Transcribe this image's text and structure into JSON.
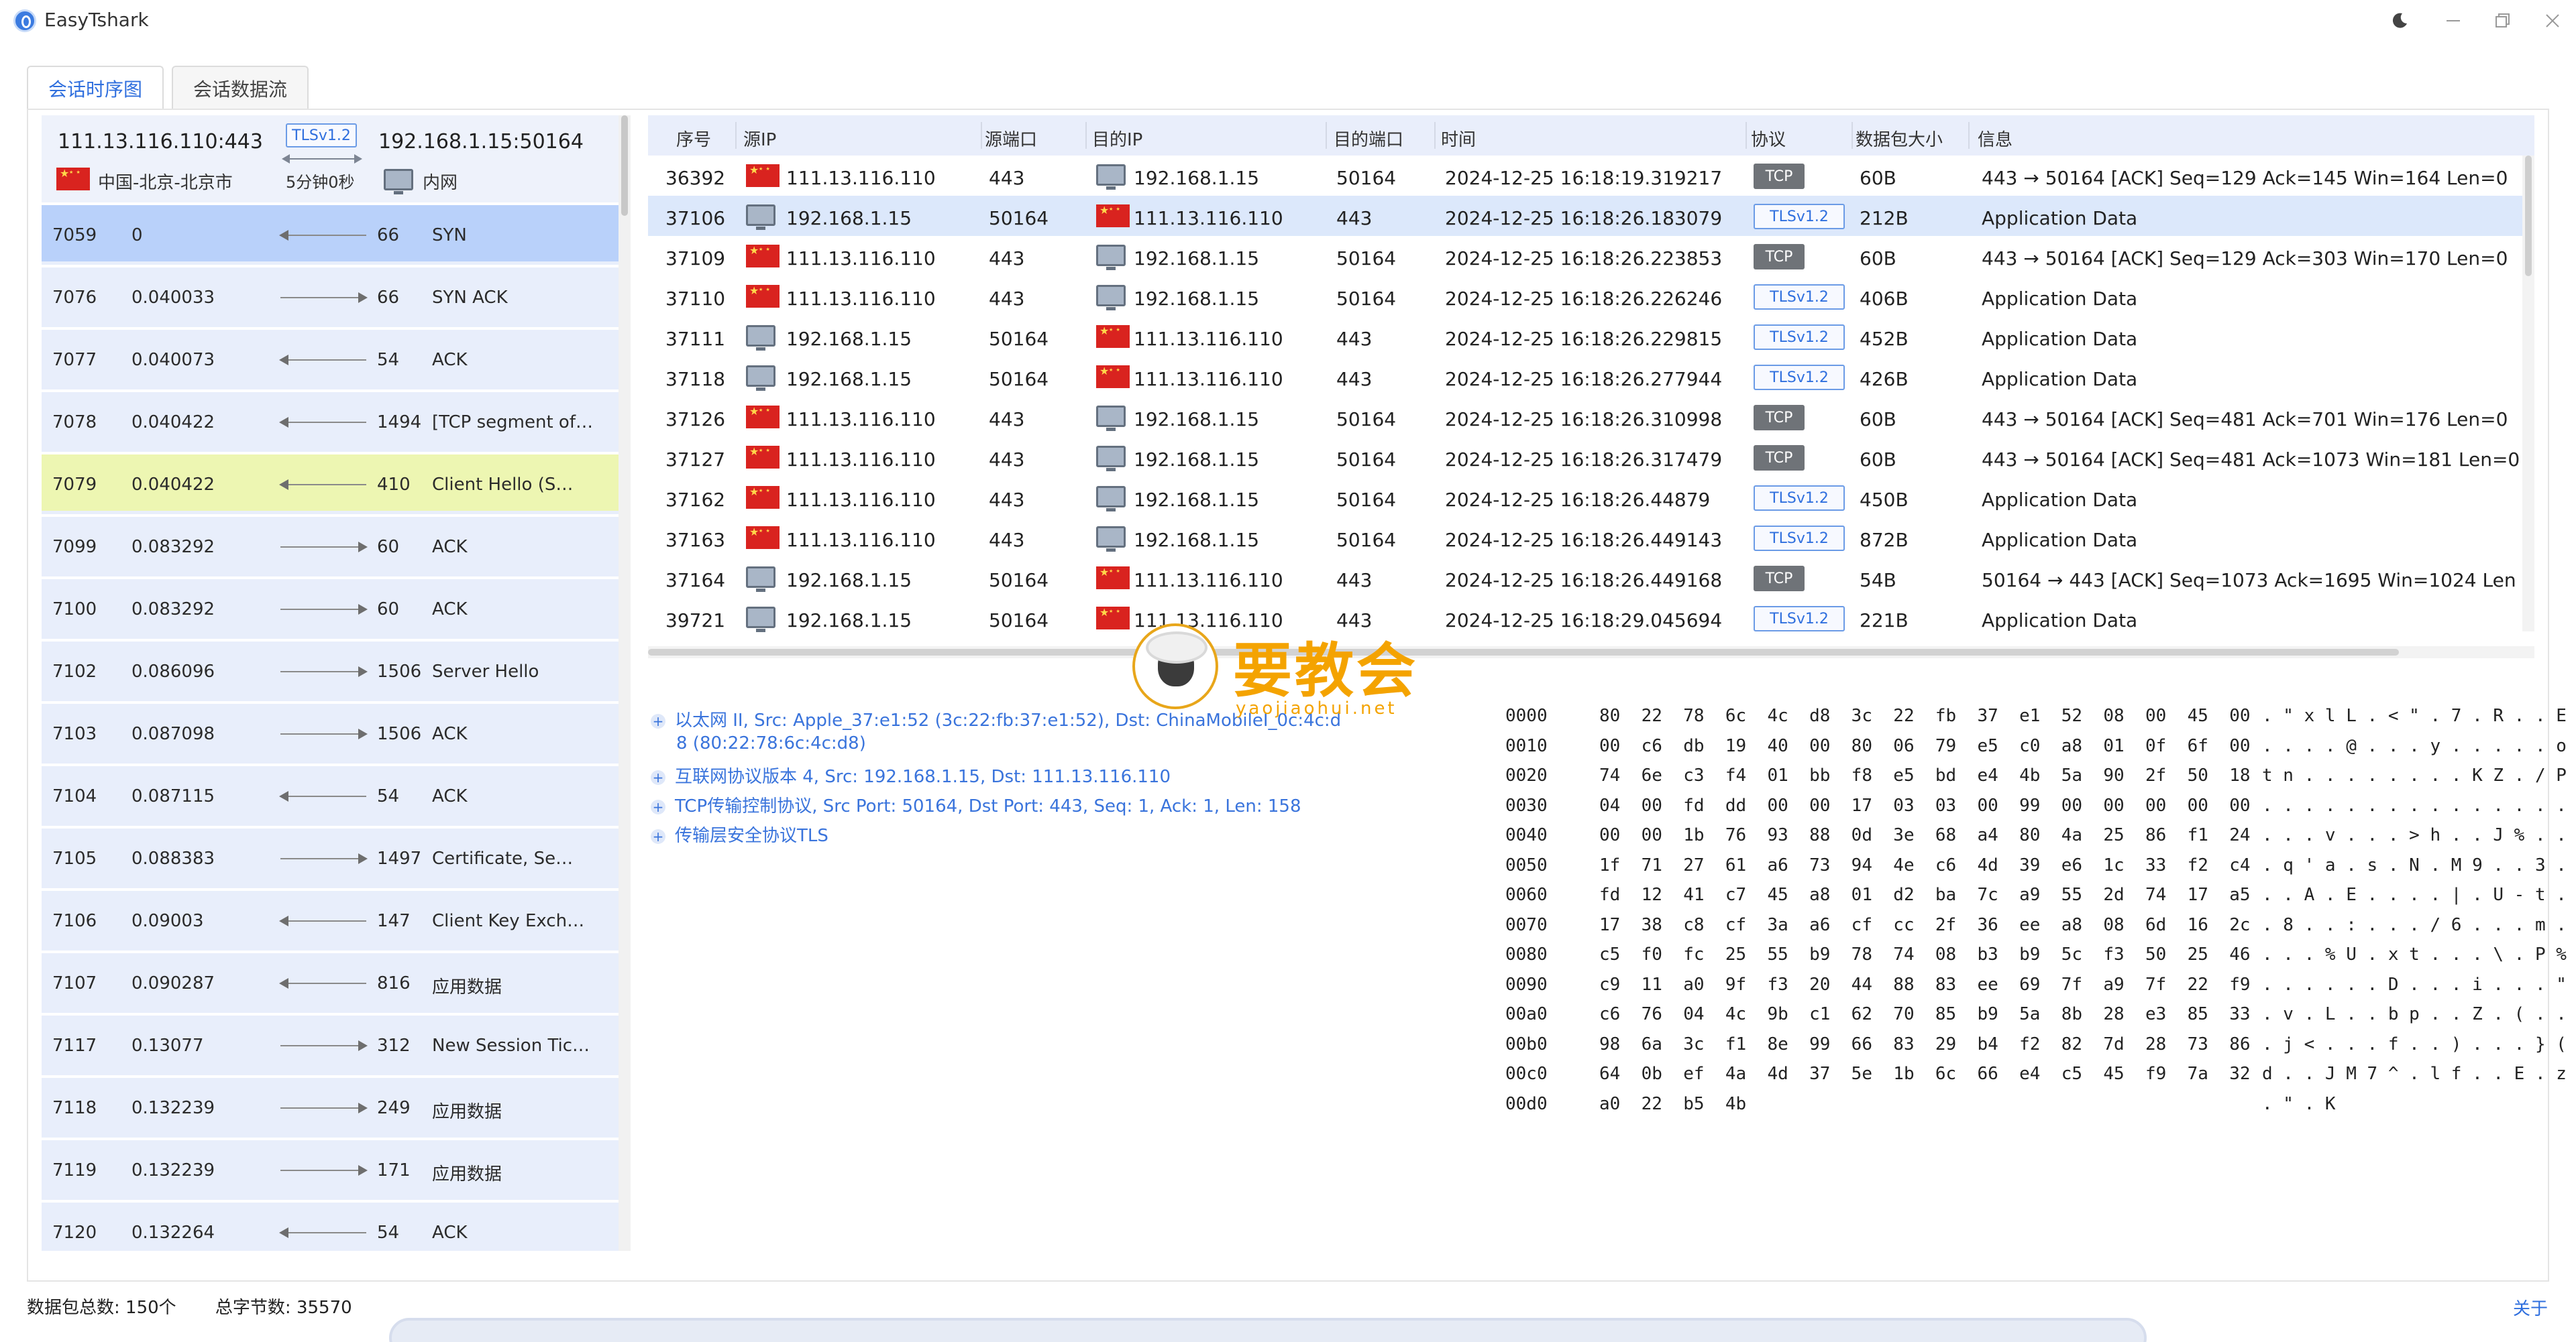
{
  "window": {
    "title": "EasyTshark"
  },
  "tabs": [
    {
      "label": "会话时序图"
    },
    {
      "label": "会话数据流"
    }
  ],
  "session": {
    "src": "111.13.116.110:443",
    "dst": "192.168.1.15:50164",
    "protocol": "TLSv1.2",
    "src_location": "中国-北京-北京市",
    "duration": "5分钟0秒",
    "dst_location": "内网"
  },
  "sequence": [
    {
      "no": "7059",
      "time": "0",
      "len": "66",
      "info": "SYN",
      "dir": "l",
      "state": "sel"
    },
    {
      "no": "7076",
      "time": "0.040033",
      "len": "66",
      "info": "SYN ACK",
      "dir": "r",
      "state": ""
    },
    {
      "no": "7077",
      "time": "0.040073",
      "len": "54",
      "info": "ACK",
      "dir": "l",
      "state": ""
    },
    {
      "no": "7078",
      "time": "0.040422",
      "len": "1494",
      "info": "[TCP segment of…",
      "dir": "l",
      "state": ""
    },
    {
      "no": "7079",
      "time": "0.040422",
      "len": "410",
      "info": "Client Hello (S…",
      "dir": "l",
      "state": "hl"
    },
    {
      "no": "7099",
      "time": "0.083292",
      "len": "60",
      "info": "ACK",
      "dir": "r",
      "state": ""
    },
    {
      "no": "7100",
      "time": "0.083292",
      "len": "60",
      "info": "ACK",
      "dir": "r",
      "state": ""
    },
    {
      "no": "7102",
      "time": "0.086096",
      "len": "1506",
      "info": "Server Hello",
      "dir": "r",
      "state": ""
    },
    {
      "no": "7103",
      "time": "0.087098",
      "len": "1506",
      "info": "ACK",
      "dir": "r",
      "state": ""
    },
    {
      "no": "7104",
      "time": "0.087115",
      "len": "54",
      "info": "ACK",
      "dir": "l",
      "state": ""
    },
    {
      "no": "7105",
      "time": "0.088383",
      "len": "1497",
      "info": "Certificate, Se…",
      "dir": "r",
      "state": ""
    },
    {
      "no": "7106",
      "time": "0.09003",
      "len": "147",
      "info": "Client Key Exch…",
      "dir": "l",
      "state": ""
    },
    {
      "no": "7107",
      "time": "0.090287",
      "len": "816",
      "info": "应用数据",
      "dir": "l",
      "state": ""
    },
    {
      "no": "7117",
      "time": "0.13077",
      "len": "312",
      "info": "New Session Tic…",
      "dir": "r",
      "state": ""
    },
    {
      "no": "7118",
      "time": "0.132239",
      "len": "249",
      "info": "应用数据",
      "dir": "r",
      "state": ""
    },
    {
      "no": "7119",
      "time": "0.132239",
      "len": "171",
      "info": "应用数据",
      "dir": "r",
      "state": ""
    },
    {
      "no": "7120",
      "time": "0.132264",
      "len": "54",
      "info": "ACK",
      "dir": "l",
      "state": ""
    }
  ],
  "packet_table": {
    "columns": [
      "序号",
      "源IP",
      "源端口",
      "目的IP",
      "目的端口",
      "时间",
      "协议",
      "数据包大小",
      "信息"
    ],
    "rows": [
      {
        "no": "36392",
        "src_ip": "111.13.116.110",
        "src_flag": "cn",
        "src_port": "443",
        "dst_ip": "192.168.1.15",
        "dst_flag": "lan",
        "dst_port": "50164",
        "time": "2024-12-25 16:18:19.319217",
        "proto": "TCP",
        "size": "60B",
        "info": "443 → 50164 [ACK] Seq=129 Ack=145 Win=164 Len=0",
        "sel": false
      },
      {
        "no": "37106",
        "src_ip": "192.168.1.15",
        "src_flag": "lan",
        "src_port": "50164",
        "dst_ip": "111.13.116.110",
        "dst_flag": "cn",
        "dst_port": "443",
        "time": "2024-12-25 16:18:26.183079",
        "proto": "TLSv1.2",
        "size": "212B",
        "info": "Application Data",
        "sel": true
      },
      {
        "no": "37109",
        "src_ip": "111.13.116.110",
        "src_flag": "cn",
        "src_port": "443",
        "dst_ip": "192.168.1.15",
        "dst_flag": "lan",
        "dst_port": "50164",
        "time": "2024-12-25 16:18:26.223853",
        "proto": "TCP",
        "size": "60B",
        "info": "443 → 50164 [ACK] Seq=129 Ack=303 Win=170 Len=0",
        "sel": false
      },
      {
        "no": "37110",
        "src_ip": "111.13.116.110",
        "src_flag": "cn",
        "src_port": "443",
        "dst_ip": "192.168.1.15",
        "dst_flag": "lan",
        "dst_port": "50164",
        "time": "2024-12-25 16:18:26.226246",
        "proto": "TLSv1.2",
        "size": "406B",
        "info": "Application Data",
        "sel": false
      },
      {
        "no": "37111",
        "src_ip": "192.168.1.15",
        "src_flag": "lan",
        "src_port": "50164",
        "dst_ip": "111.13.116.110",
        "dst_flag": "cn",
        "dst_port": "443",
        "time": "2024-12-25 16:18:26.229815",
        "proto": "TLSv1.2",
        "size": "452B",
        "info": "Application Data",
        "sel": false
      },
      {
        "no": "37118",
        "src_ip": "192.168.1.15",
        "src_flag": "lan",
        "src_port": "50164",
        "dst_ip": "111.13.116.110",
        "dst_flag": "cn",
        "dst_port": "443",
        "time": "2024-12-25 16:18:26.277944",
        "proto": "TLSv1.2",
        "size": "426B",
        "info": "Application Data",
        "sel": false
      },
      {
        "no": "37126",
        "src_ip": "111.13.116.110",
        "src_flag": "cn",
        "src_port": "443",
        "dst_ip": "192.168.1.15",
        "dst_flag": "lan",
        "dst_port": "50164",
        "time": "2024-12-25 16:18:26.310998",
        "proto": "TCP",
        "size": "60B",
        "info": "443 → 50164 [ACK] Seq=481 Ack=701 Win=176 Len=0",
        "sel": false
      },
      {
        "no": "37127",
        "src_ip": "111.13.116.110",
        "src_flag": "cn",
        "src_port": "443",
        "dst_ip": "192.168.1.15",
        "dst_flag": "lan",
        "dst_port": "50164",
        "time": "2024-12-25 16:18:26.317479",
        "proto": "TCP",
        "size": "60B",
        "info": "443 → 50164 [ACK] Seq=481 Ack=1073 Win=181 Len=0",
        "sel": false
      },
      {
        "no": "37162",
        "src_ip": "111.13.116.110",
        "src_flag": "cn",
        "src_port": "443",
        "dst_ip": "192.168.1.15",
        "dst_flag": "lan",
        "dst_port": "50164",
        "time": "2024-12-25 16:18:26.44879",
        "proto": "TLSv1.2",
        "size": "450B",
        "info": "Application Data",
        "sel": false
      },
      {
        "no": "37163",
        "src_ip": "111.13.116.110",
        "src_flag": "cn",
        "src_port": "443",
        "dst_ip": "192.168.1.15",
        "dst_flag": "lan",
        "dst_port": "50164",
        "time": "2024-12-25 16:18:26.449143",
        "proto": "TLSv1.2",
        "size": "872B",
        "info": "Application Data",
        "sel": false
      },
      {
        "no": "37164",
        "src_ip": "192.168.1.15",
        "src_flag": "lan",
        "src_port": "50164",
        "dst_ip": "111.13.116.110",
        "dst_flag": "cn",
        "dst_port": "443",
        "time": "2024-12-25 16:18:26.449168",
        "proto": "TCP",
        "size": "54B",
        "info": "50164 → 443 [ACK] Seq=1073 Ack=1695 Win=1024 Len",
        "sel": false
      },
      {
        "no": "39721",
        "src_ip": "192.168.1.15",
        "src_flag": "lan",
        "src_port": "50164",
        "dst_ip": "111.13.116.110",
        "dst_flag": "cn",
        "dst_port": "443",
        "time": "2024-12-25 16:18:29.045694",
        "proto": "TLSv1.2",
        "size": "221B",
        "info": "Application Data",
        "sel": false
      }
    ]
  },
  "details": {
    "ethernet_line1": "以太网 II, Src: Apple_37:e1:52 (3c:22:fb:37:e1:52), Dst: ChinaMobileI_0c:4c:d",
    "ethernet_line2": "8 (80:22:78:6c:4c:d8)",
    "ip": "互联网协议版本 4, Src: 192.168.1.15, Dst: 111.13.116.110",
    "tcp": "TCP传输控制协议, Src Port: 50164, Dst Port: 443, Seq: 1, Ack: 1, Len: 158",
    "tls": "传输层安全协议TLS"
  },
  "hex_dump": {
    "offsets": [
      "0000",
      "0010",
      "0020",
      "0030",
      "0040",
      "0050",
      "0060",
      "0070",
      "0080",
      "0090",
      "00a0",
      "00b0",
      "00c0",
      "00d0"
    ],
    "bytes": [
      "80  22  78  6c  4c  d8  3c  22  fb  37  e1  52  08  00  45  00",
      "00  c6  db  19  40  00  80  06  79  e5  c0  a8  01  0f  6f  00",
      "74  6e  c3  f4  01  bb  f8  e5  bd  e4  4b  5a  90  2f  50  18",
      "04  00  fd  dd  00  00  17  03  03  00  99  00  00  00  00  00",
      "00  00  1b  76  93  88  0d  3e  68  a4  80  4a  25  86  f1  24",
      "1f  71  27  61  a6  73  94  4e  c6  4d  39  e6  1c  33  f2  c4",
      "fd  12  41  c7  45  a8  01  d2  ba  7c  a9  55  2d  74  17  a5",
      "17  38  c8  cf  3a  a6  cf  cc  2f  36  ee  a8  08  6d  16  2c",
      "c5  f0  fc  25  55  b9  78  74  08  b3  b9  5c  f3  50  25  46",
      "c9  11  a0  9f  f3  20  44  88  83  ee  69  7f  a9  7f  22  f9",
      "c6  76  04  4c  9b  c1  62  70  85  b9  5a  8b  28  e3  85  33",
      "98  6a  3c  f1  8e  99  66  83  29  b4  f2  82  7d  28  73  86",
      "64  0b  ef  4a  4d  37  5e  1b  6c  66  e4  c5  45  f9  7a  32",
      "a0  22  b5  4b"
    ],
    "ascii": [
      ". \" x l L . < \" . 7 . R . . E .",
      ". . . . @ . . . y . . . . . o .",
      "t n . . . . . . . . K Z . / P .",
      ". . . . . . . . . . . . . . . .",
      ". . . v . . . > h . . J % . . $",
      ". q ' a . s . N . M 9 . . 3 . .",
      ". . A . E . . . . | . U - t . .",
      ". 8 . . : . . . / 6 . . . m . ,",
      ". . . % U . x t . . . \\ . P % F",
      ". . . . . . D . . . i . . . \" .",
      ". v . L . . b p . . Z . ( . . 3",
      ". j < . . . f . . ) . . . } ( s",
      "d . . J M 7 ^ . l f . . E . z 2",
      ". \" . K"
    ]
  },
  "footer": {
    "packet_count": "数据包总数: 150个",
    "byte_count": "总字节数: 35570",
    "about": "关于"
  },
  "watermark": {
    "text": "要教会",
    "url": "yaojiaohui.net"
  }
}
